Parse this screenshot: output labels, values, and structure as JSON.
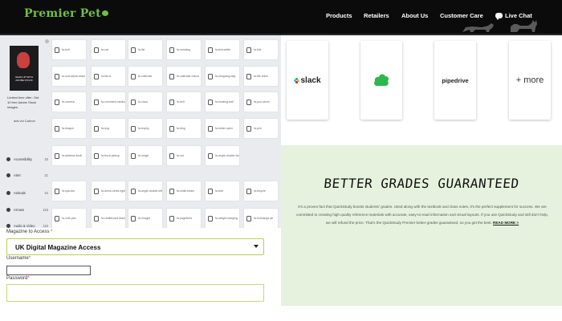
{
  "header": {
    "logo_text": "Premier Pet",
    "nav": {
      "products": "Products",
      "retailers": "Retailers",
      "about": "About Us",
      "care": "Customer Care",
      "chat": "Live Chat"
    },
    "brand_color": "#6fbe44"
  },
  "promo": {
    "image_text": "GEAR UP WITH ADOBE STOCK",
    "body": "Limited time offer: Get 10 free Adobe Stock images.",
    "credit": "ads via Carbon"
  },
  "categories": [
    {
      "label": "Accessibility",
      "count": "15"
    },
    {
      "label": "Alert",
      "count": "21"
    },
    {
      "label": "Animals",
      "count": "44"
    },
    {
      "label": "Arrows",
      "count": "115"
    },
    {
      "label": "Audio & Video",
      "count": "115"
    }
  ],
  "icons": [
    [
      "fa-bolt",
      "fa-cat",
      "fa-list",
      "fa-smoking",
      "fa-text-width",
      "fa-link"
    ],
    [
      "fa-sort-alpha-down",
      "fa-list-ol",
      "fa-calendar",
      "fa-calendar-minus",
      "fa-shopping-bag",
      "fa-file-video"
    ],
    [
      "fa-camera",
      "fa-comment-medical",
      "fa-cloud",
      "fa-bell",
      "fa-bowling-ball",
      "fa-poo-storm"
    ],
    [
      "fa-dragon",
      "fa-dog",
      "fa-trophy",
      "fa-blog",
      "fa-folder-open",
      "fa-pen"
    ],
    [
      "fa-address-book",
      "fa-truck-pickup",
      "fa-magic",
      "fa-car",
      "fa-angle-double-down"
    ],
    [
      "fa-spa-slot",
      "fa-arrow-circle-right",
      "fa-angle-double-left",
      "fa-smile-beam",
      "fa-leaf",
      "fa-bicycle"
    ],
    [
      "fa-vote-yea",
      "fa-chalkboard-teacher",
      "fa-images",
      "fa-pagelines",
      "fa-weight-hanging",
      "fa-exchange-alt"
    ]
  ],
  "form": {
    "magazine_label": "Magazine to Access",
    "magazine_value": "UK Digital Magazine Access",
    "username_label": "Username",
    "password_label": "Password",
    "required_mark": "*"
  },
  "integrations": {
    "slack": "slack",
    "pipedrive": "pipedrive",
    "more": "+ more"
  },
  "promo_banner": {
    "title": "BETTER GRADES GUARANTEED",
    "body": "It's a proven fact that QuickStudy boosts students' grades. Used along with the textbook and class notes, it's the perfect supplement for success. We are committed to creating high quality reference materials with accurate, easy-to-read information and visual layouts. If you use QuickStudy and still don't help, we will refund the price. That's the QuickStudy Premier better grades guaranteed, so you get the best.",
    "read_more": "READ MORE >",
    "bg_color": "#e6f2dd"
  }
}
